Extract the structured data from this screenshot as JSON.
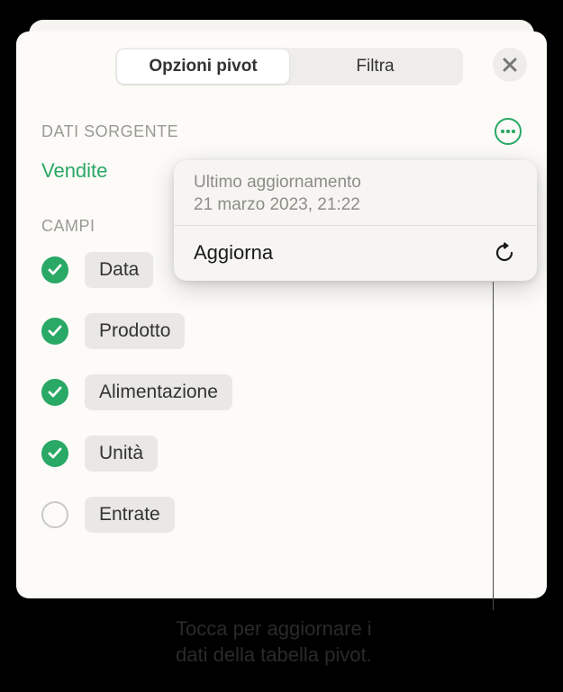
{
  "tabs": {
    "pivot": "Opzioni pivot",
    "filter": "Filtra"
  },
  "sections": {
    "source_label": "DATI SORGENTE",
    "source_name": "Vendite",
    "fields_label": "CAMPI"
  },
  "fields": [
    {
      "label": "Data",
      "checked": true
    },
    {
      "label": "Prodotto",
      "checked": true
    },
    {
      "label": "Alimentazione",
      "checked": true
    },
    {
      "label": "Unità",
      "checked": true
    },
    {
      "label": "Entrate",
      "checked": false
    }
  ],
  "popover": {
    "last_update_label": "Ultimo aggiornamento",
    "last_update_time": "21 marzo 2023, 21:22",
    "refresh_label": "Aggiorna"
  },
  "callout": {
    "line1": "Tocca per aggiornare i",
    "line2": "dati della tabella pivot."
  }
}
